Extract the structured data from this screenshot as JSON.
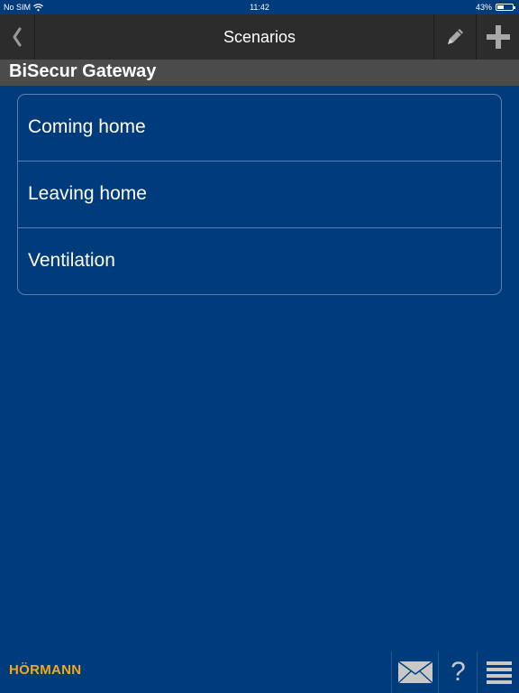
{
  "status_bar": {
    "carrier": "No SIM",
    "time": "11:42",
    "battery_percent": "43%",
    "battery_level": 0.43
  },
  "nav": {
    "title": "Scenarios",
    "back_icon": "chevron-left-icon",
    "edit_icon": "pencil-icon",
    "add_icon": "plus-icon"
  },
  "section": {
    "title": "BiSecur Gateway"
  },
  "scenarios": [
    {
      "label": "Coming home"
    },
    {
      "label": "Leaving home"
    },
    {
      "label": "Ventilation"
    }
  ],
  "footer": {
    "logo": "HÖRMANN",
    "messages_icon": "envelope-icon",
    "help_icon": "question-mark-icon",
    "menu_icon": "hamburger-menu-icon"
  },
  "colors": {
    "background": "#003b7c",
    "nav_bar": "#2c2c2c",
    "section_header": "#4b4b4b",
    "logo": "#f3a81c"
  }
}
